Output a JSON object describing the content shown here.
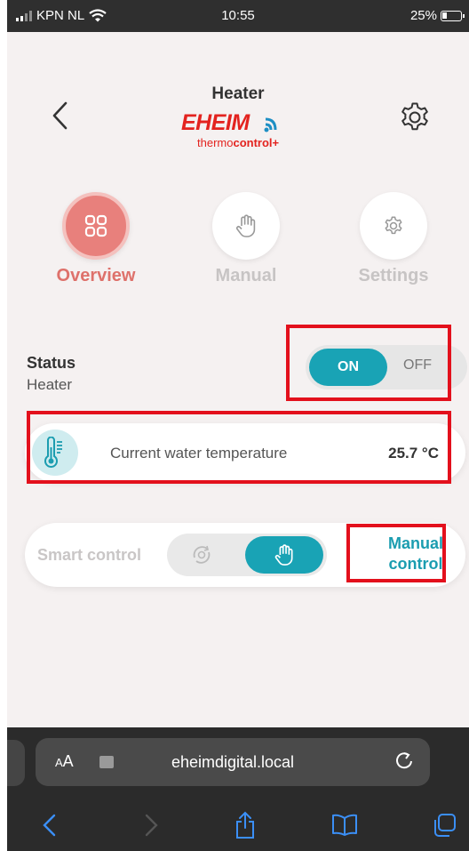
{
  "status_bar": {
    "carrier": "KPN NL",
    "time": "10:55",
    "battery": "25%"
  },
  "header": {
    "title": "Heater",
    "logo_text": "EHEIM",
    "logo_sub_a": "thermo",
    "logo_sub_b": "control",
    "logo_sub_c": "+"
  },
  "tabs": [
    {
      "label": "Overview",
      "icon": "grid-icon",
      "active": true
    },
    {
      "label": "Manual",
      "icon": "hand-icon",
      "active": false
    },
    {
      "label": "Settings",
      "icon": "gear-icon",
      "active": false
    }
  ],
  "status": {
    "label": "Status",
    "sublabel": "Heater",
    "on_label": "ON",
    "off_label": "OFF",
    "value": "ON"
  },
  "temperature": {
    "label": "Current water temperature",
    "value": "25.7 °C"
  },
  "control": {
    "smart_label": "Smart control",
    "mode": "manual",
    "manual_line1": "Manual",
    "manual_line2": "control"
  },
  "browser": {
    "text_size_label": "AA",
    "url": "eheimdigital.local"
  },
  "colors": {
    "accent_teal": "#19a3b5",
    "accent_coral": "#e8807c",
    "brand_red": "#e3231f",
    "highlight_red": "#e3101c"
  }
}
